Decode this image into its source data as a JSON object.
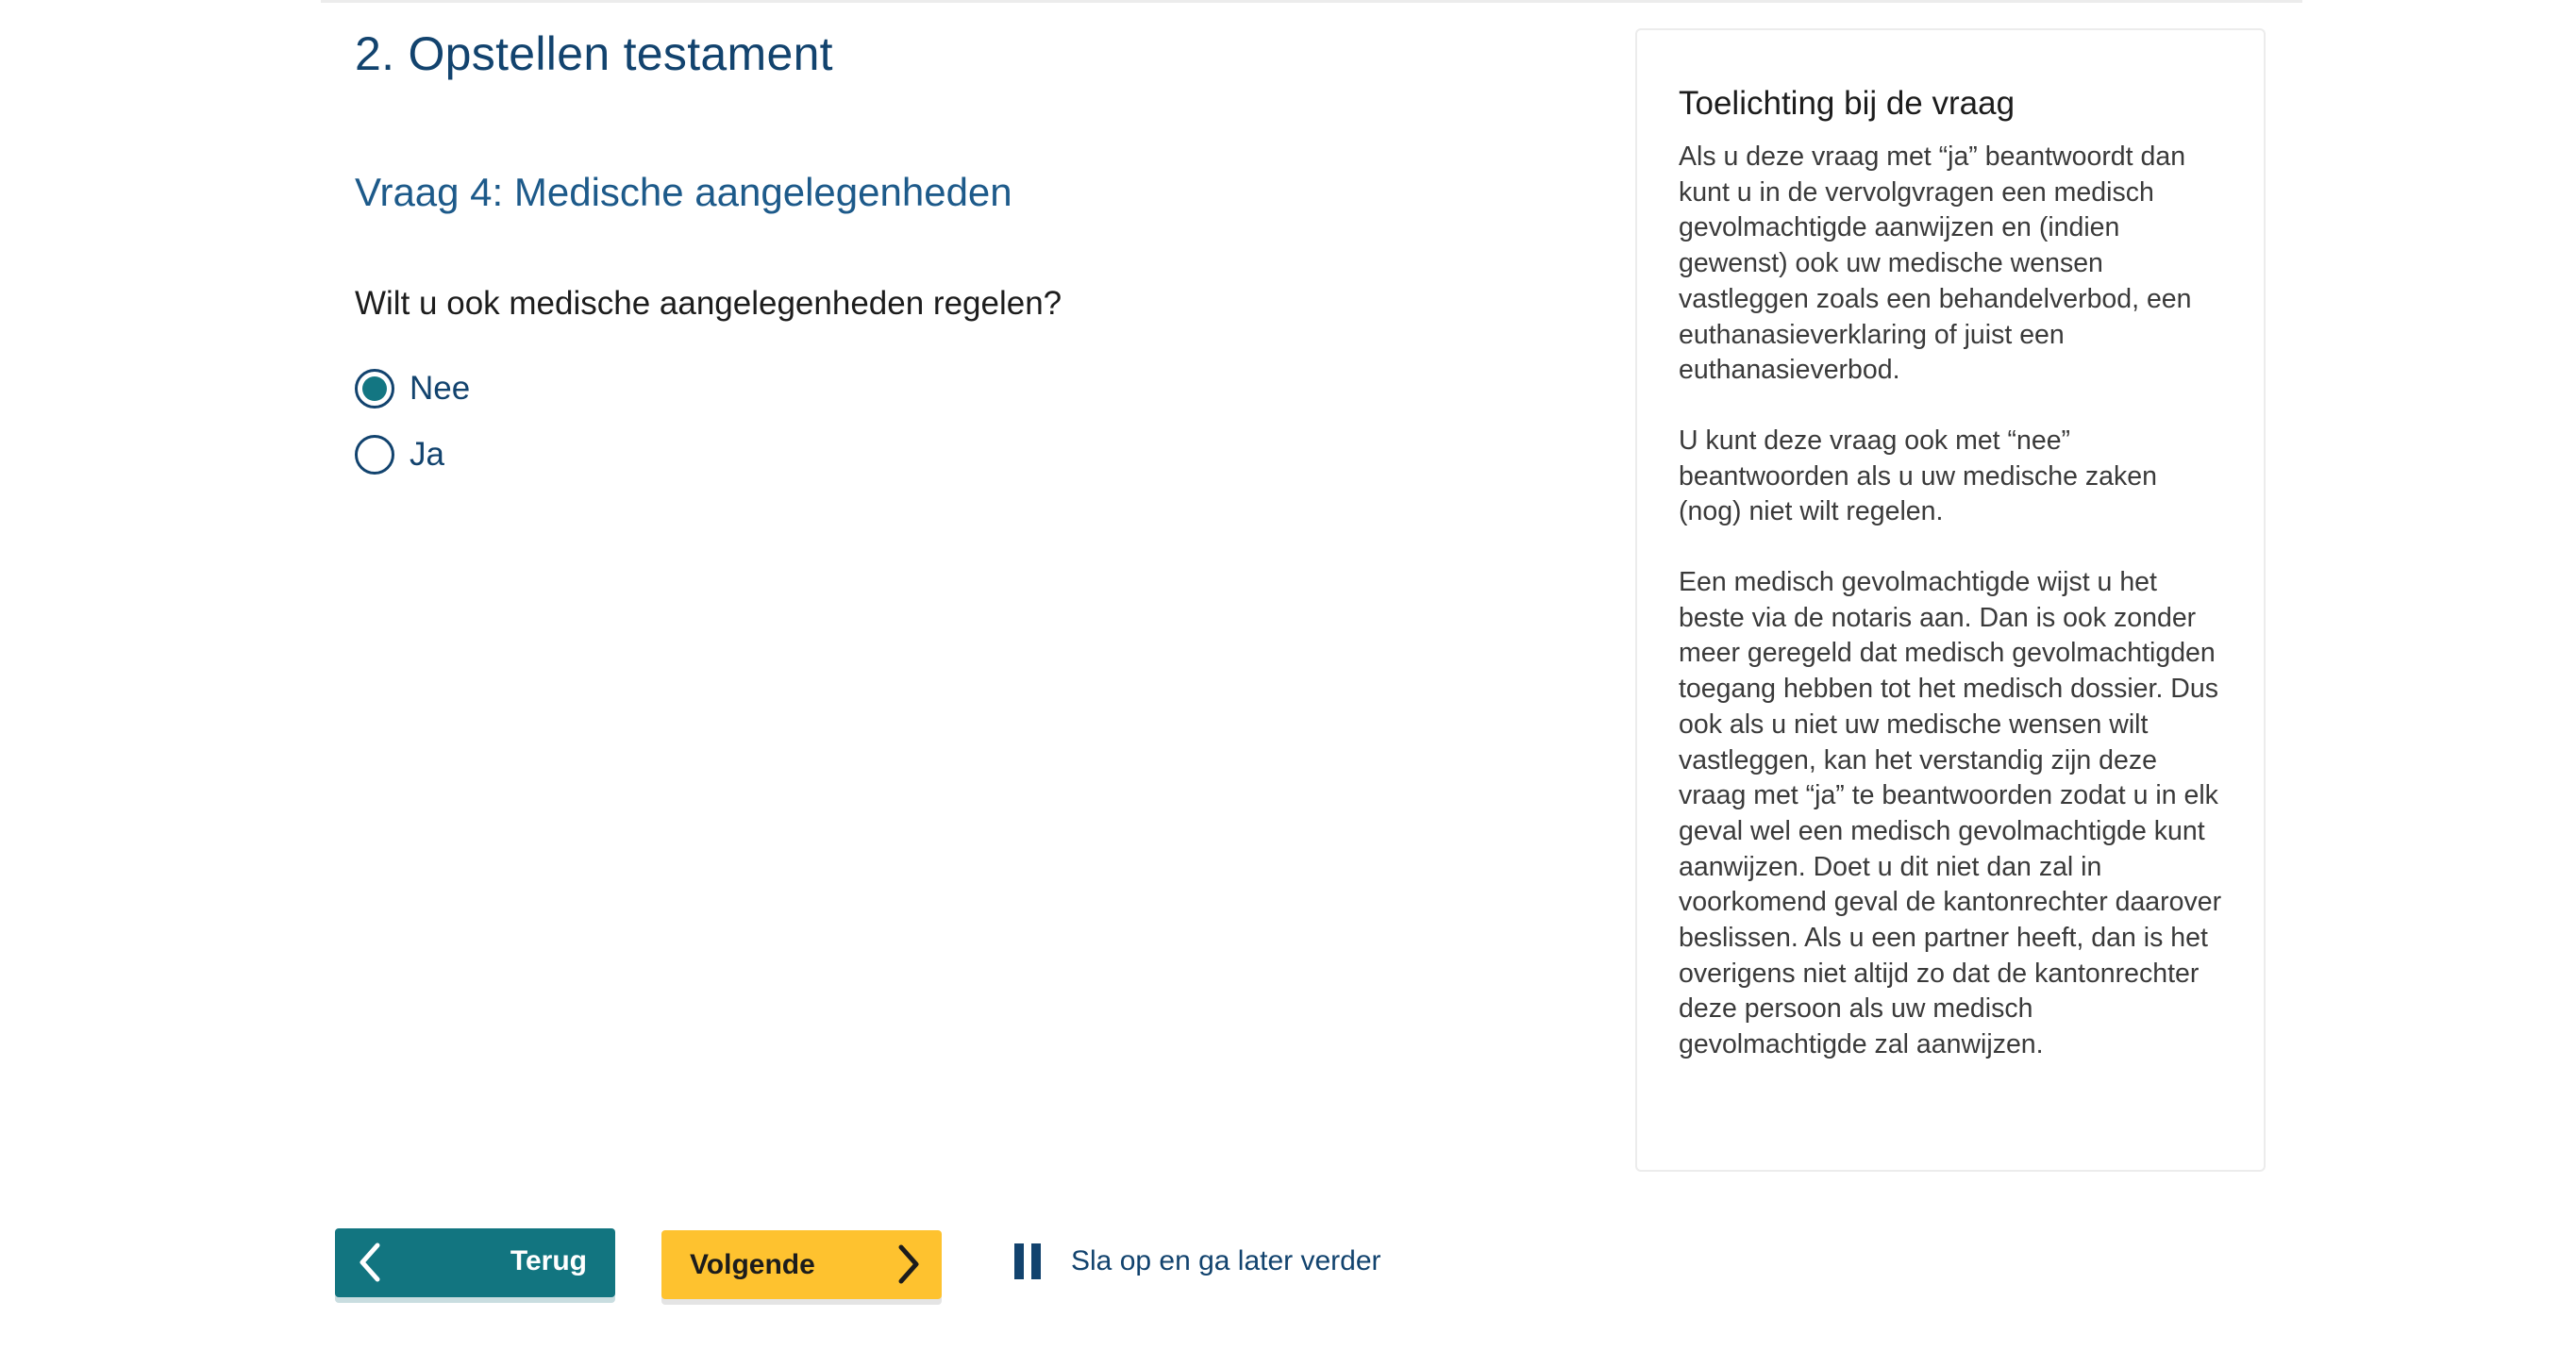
{
  "section": {
    "title": "2. Opstellen testament"
  },
  "question": {
    "title": "Vraag 4: Medische aangelegenheden",
    "text": "Wilt u ook medische aangelegenheden regelen?",
    "options": [
      {
        "label": "Nee",
        "selected": true
      },
      {
        "label": "Ja",
        "selected": false
      }
    ]
  },
  "help": {
    "title": "Toelichting bij de vraag",
    "paragraphs": [
      "Als u deze vraag met “ja” beantwoordt dan kunt u in de vervolgvragen een medisch gevolmachtigde aanwijzen en (indien gewenst) ook uw medische wensen vastleggen zoals een behandelverbod, een euthanasieverklaring of juist een euthanasieverbod.",
      "U kunt deze vraag ook met “nee” beantwoorden als u uw medische zaken (nog) niet wilt regelen.",
      "Een medisch gevolmachtigde wijst u het beste via de notaris aan. Dan is ook zonder meer geregeld dat medisch gevolmachtigden toegang hebben tot het medisch dossier. Dus ook als u niet uw medische wensen wilt vastleggen, kan het verstandig zijn deze vraag met “ja” te beantwoorden zodat u in elk geval wel een medisch gevolmachtigde kunt aanwijzen. Doet u dit niet dan zal in voorkomend geval de kantonrechter daarover beslissen. Als u een partner heeft, dan is het overigens niet altijd zo dat de kantonrechter deze persoon als uw medisch gevolmachtigde zal aanwijzen."
    ]
  },
  "nav": {
    "back_label": "Terug",
    "next_label": "Volgende",
    "save_label": "Sla op en ga later verder",
    "icons": {
      "back": "chevron-left-icon",
      "next": "chevron-right-icon",
      "save": "pause-icon"
    }
  },
  "colors": {
    "primary_blue": "#12436e",
    "teal": "#127580",
    "yellow": "#fec22f"
  }
}
